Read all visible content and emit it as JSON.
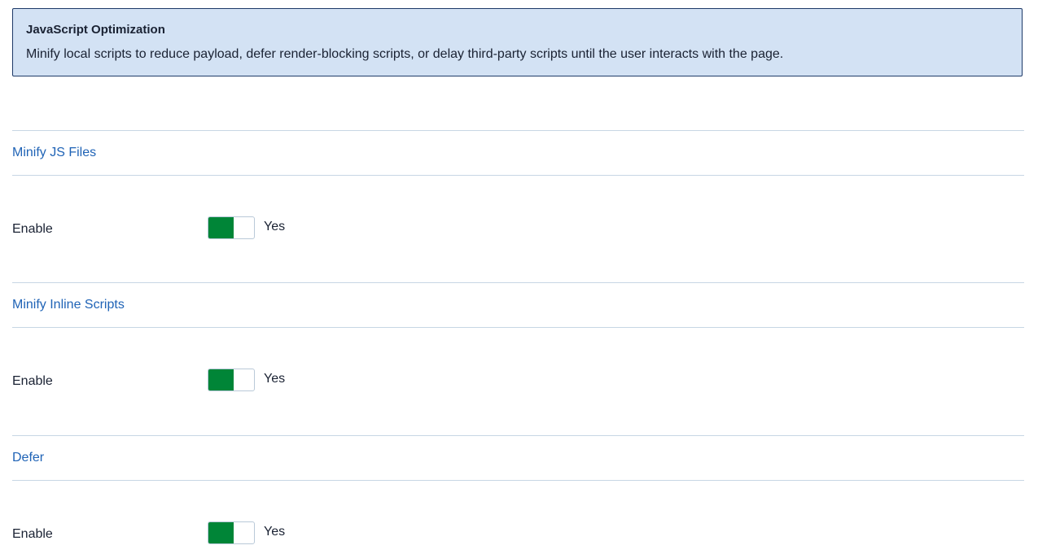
{
  "info": {
    "title": "JavaScript Optimization",
    "text": "Minify local scripts to reduce payload, defer render-blocking scripts, or delay third-party scripts until the user interacts with the page."
  },
  "sections": [
    {
      "title": "Minify JS Files",
      "field_label": "Enable",
      "toggle_on": true,
      "value_label": "Yes"
    },
    {
      "title": "Minify Inline Scripts",
      "field_label": "Enable",
      "toggle_on": true,
      "value_label": "Yes"
    },
    {
      "title": "Defer",
      "field_label": "Enable",
      "toggle_on": true,
      "value_label": "Yes"
    }
  ],
  "colors": {
    "info_bg": "#d3e2f4",
    "section_title": "#1f63b6",
    "toggle_on": "#008537"
  }
}
